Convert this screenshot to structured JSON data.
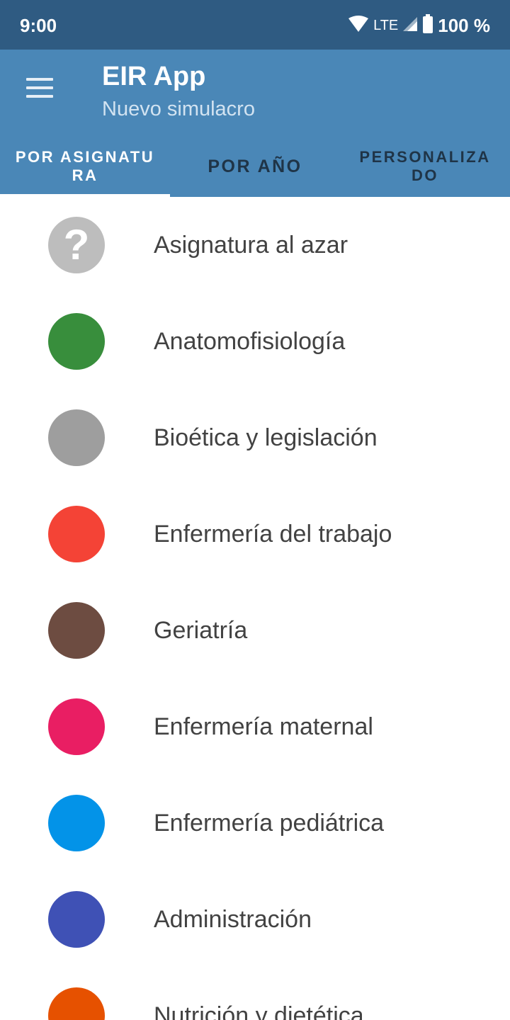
{
  "status_bar": {
    "time": "9:00",
    "network": "LTE",
    "battery": "100 %",
    "icons": [
      "wifi-icon",
      "signal-icon",
      "battery-icon"
    ]
  },
  "app_bar": {
    "title": "EIR App",
    "subtitle": "Nuevo simulacro",
    "menu_icon": "hamburger-menu-icon"
  },
  "tabs": [
    {
      "label": "POR ASIGNATURA",
      "active": true
    },
    {
      "label": "POR AÑO",
      "active": false
    },
    {
      "label": "PERSONALIZADO",
      "active": false
    }
  ],
  "subjects": [
    {
      "label": "Asignatura al azar",
      "color": "#bdbdbd",
      "icon": "?"
    },
    {
      "label": "Anatomofisiología",
      "color": "#388e3c",
      "icon": ""
    },
    {
      "label": "Bioética y legislación",
      "color": "#9e9e9e",
      "icon": ""
    },
    {
      "label": "Enfermería del trabajo",
      "color": "#f44336",
      "icon": ""
    },
    {
      "label": "Geriatría",
      "color": "#6d4c41",
      "icon": ""
    },
    {
      "label": "Enfermería maternal",
      "color": "#e91e63",
      "icon": ""
    },
    {
      "label": "Enfermería pediátrica",
      "color": "#0393e8",
      "icon": ""
    },
    {
      "label": "Administración",
      "color": "#3f51b5",
      "icon": ""
    },
    {
      "label": "Nutrición y dietética",
      "color": "#e65100",
      "icon": ""
    }
  ],
  "colors": {
    "status_bar": "#2f5b82",
    "app_bar": "#4a87b7",
    "subtitle": "#d2e3f1",
    "inactive_tab": "#1f3447"
  }
}
